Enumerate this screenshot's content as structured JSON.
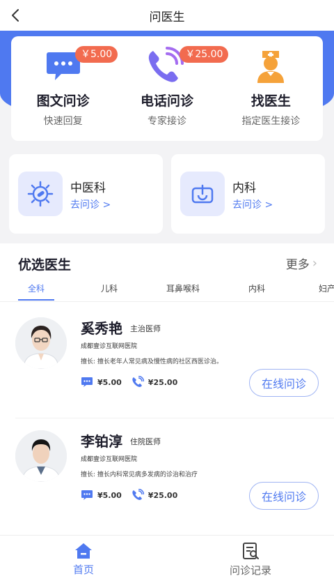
{
  "header": {
    "title": "问医生"
  },
  "services": [
    {
      "title": "图文问诊",
      "subtitle": "快速回复",
      "price": "￥5.00",
      "icon": "chat-bubble-icon"
    },
    {
      "title": "电话问诊",
      "subtitle": "专家接诊",
      "price": "￥25.00",
      "icon": "phone-icon"
    },
    {
      "title": "找医生",
      "subtitle": "指定医生接诊",
      "icon": "nurse-icon"
    }
  ],
  "departments": [
    {
      "name": "中医科",
      "link": "去问诊 >",
      "icon": "virus-icon"
    },
    {
      "name": "内科",
      "link": "去问诊 >",
      "icon": "internal-medicine-icon"
    }
  ],
  "doctor_section": {
    "title": "优选医生",
    "more": "更多",
    "tabs": [
      "全科",
      "儿科",
      "耳鼻喉科",
      "内科",
      "妇产"
    ],
    "active_tab": "全科"
  },
  "doctors": [
    {
      "name": "奚秀艳",
      "title": "主治医师",
      "hospital": "成都壹诊互联网医院",
      "skill": "擅长: 擅长老年人常见病及慢性病的社区西医诊治。",
      "text_price": "¥5.00",
      "phone_price": "¥25.00",
      "button": "在线问诊"
    },
    {
      "name": "李铂淳",
      "title": "住院医师",
      "hospital": "成都壹诊互联网医院",
      "skill": "擅长: 擅长内科常见病多发病的诊治和治疗",
      "text_price": "¥5.00",
      "phone_price": "¥25.00",
      "button": "在线问诊"
    }
  ],
  "bottom_nav": [
    {
      "label": "首页",
      "icon": "home-icon",
      "active": true
    },
    {
      "label": "问诊记录",
      "icon": "records-icon",
      "active": false
    }
  ],
  "colors": {
    "primary": "#4f79f0",
    "badge": "#f26b4f",
    "nurse": "#f5a23a"
  }
}
